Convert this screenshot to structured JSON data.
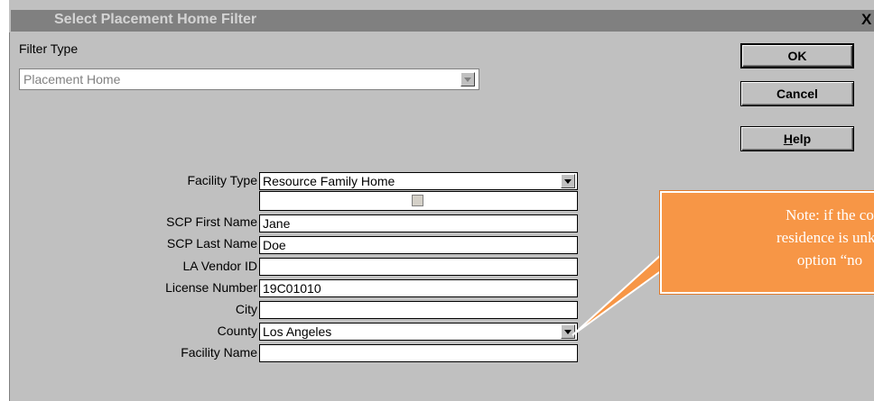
{
  "window": {
    "title": "Select Placement Home Filter",
    "close_glyph": "X"
  },
  "filter_type": {
    "label": "Filter Type",
    "value": "Placement Home"
  },
  "buttons": {
    "ok": "OK",
    "cancel": "Cancel",
    "help": "Help"
  },
  "form": {
    "facility_type": {
      "label": "Facility Type",
      "value": "Resource Family Home"
    },
    "scp_first_name": {
      "label": "SCP First Name",
      "value": "Jane"
    },
    "scp_last_name": {
      "label": "SCP Last Name",
      "value": "Doe"
    },
    "la_vendor_id": {
      "label": "LA Vendor ID",
      "value": ""
    },
    "license_number": {
      "label": "License Number",
      "value": "19C01010"
    },
    "city": {
      "label": "City",
      "value": ""
    },
    "county": {
      "label": "County",
      "value": "Los Angeles"
    },
    "facility_name": {
      "label": "Facility Name",
      "value": ""
    }
  },
  "callout": {
    "line1": "Note: if the co",
    "line2": "residence is unkn",
    "line3": "option “no"
  },
  "colors": {
    "window_bg": "#c0c0c0",
    "callout_fill": "#f79646"
  }
}
